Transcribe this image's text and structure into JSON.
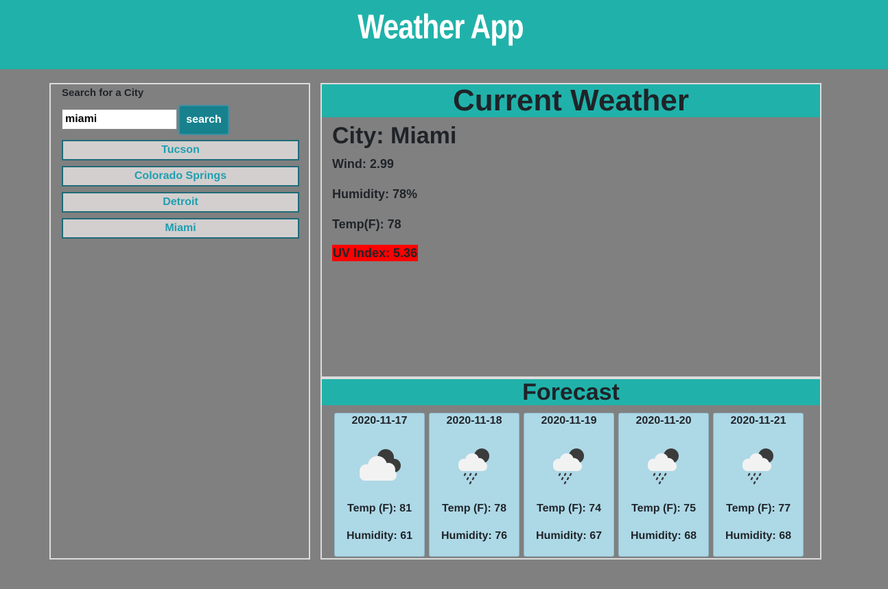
{
  "header": {
    "title": "Weather App"
  },
  "sidebar": {
    "label": "Search for a City",
    "search_value": "miami",
    "search_button": "search",
    "cities": [
      "Tucson",
      "Colorado Springs",
      "Detroit",
      "Miami"
    ]
  },
  "current": {
    "heading": "Current Weather",
    "city": "City: Miami",
    "wind": "Wind: 2.99",
    "humidity": "Humidity: 78%",
    "temp": "Temp(F): 78",
    "uv": "UV Index: 5.36"
  },
  "forecast": {
    "heading": "Forecast",
    "days": [
      {
        "date": "2020-11-17",
        "icon": "cloud-moon-icon",
        "temp": "Temp (F): 81",
        "humidity": "Humidity: 61"
      },
      {
        "date": "2020-11-18",
        "icon": "cloud-moon-rain-icon",
        "temp": "Temp (F): 78",
        "humidity": "Humidity: 76"
      },
      {
        "date": "2020-11-19",
        "icon": "cloud-moon-rain-icon",
        "temp": "Temp (F): 74",
        "humidity": "Humidity: 67"
      },
      {
        "date": "2020-11-20",
        "icon": "cloud-moon-rain-icon",
        "temp": "Temp (F): 75",
        "humidity": "Humidity: 68"
      },
      {
        "date": "2020-11-21",
        "icon": "cloud-moon-rain-icon",
        "temp": "Temp (F): 77",
        "humidity": "Humidity: 68"
      }
    ]
  },
  "colors": {
    "accent": "#20b2aa",
    "background": "#808080",
    "card": "#add8e6",
    "uv_high": "#ff0000"
  }
}
